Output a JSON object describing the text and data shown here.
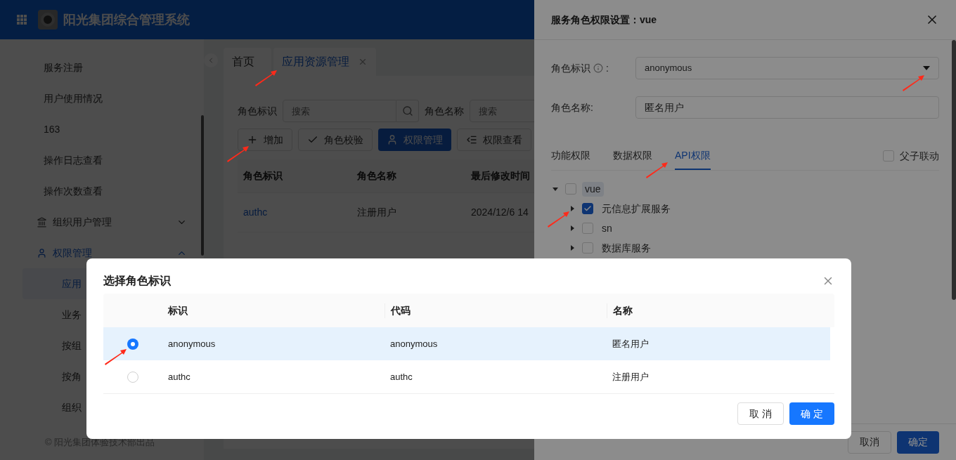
{
  "app": {
    "title": "阳光集团综合管理系统"
  },
  "sidebar": {
    "items": [
      {
        "label": "服务注册",
        "kind": "link"
      },
      {
        "label": "用户使用情况",
        "kind": "link"
      },
      {
        "label": "163",
        "kind": "link"
      },
      {
        "label": "操作日志查看",
        "kind": "link"
      },
      {
        "label": "操作次数查看",
        "kind": "link"
      },
      {
        "label": "组织用户管理",
        "kind": "group",
        "active": false,
        "expanded": false
      },
      {
        "label": "权限管理",
        "kind": "group",
        "active": true,
        "expanded": true,
        "children": [
          {
            "label": "应用",
            "selected": true
          },
          {
            "label": "业务",
            "selected": false
          },
          {
            "label": "按组",
            "selected": false
          },
          {
            "label": "按角",
            "selected": false
          },
          {
            "label": "组织",
            "selected": false
          }
        ]
      }
    ],
    "footer": "© 阳光集团体验技术部出品"
  },
  "page_tabs": [
    {
      "label": "首页",
      "selected": false,
      "closable": false
    },
    {
      "label": "应用资源管理",
      "selected": true,
      "closable": true
    }
  ],
  "filters": [
    {
      "label": "角色标识",
      "placeholder": "搜索",
      "search_button": true
    },
    {
      "label": "角色名称",
      "placeholder": "搜索",
      "search_button": false
    }
  ],
  "toolbar": [
    {
      "label": "增加",
      "primary": false
    },
    {
      "label": "角色校验",
      "primary": false
    },
    {
      "label": "权限管理",
      "primary": true
    },
    {
      "label": "权限查看",
      "primary": false
    }
  ],
  "table": {
    "columns": [
      "角色标识",
      "角色名称",
      "最后修改时间"
    ],
    "rows": [
      [
        "authc",
        "注册用户",
        "2024/12/6 14"
      ]
    ]
  },
  "drawer": {
    "title": "服务角色权限设置：vue",
    "role_id": {
      "label": "角色标识",
      "suffix": ":",
      "value": "anonymous"
    },
    "role_name": {
      "label": "角色名称:",
      "value": "匿名用户"
    },
    "tabs": [
      {
        "label": "功能权限",
        "selected": false
      },
      {
        "label": "数据权限",
        "selected": false
      },
      {
        "label": "API权限",
        "selected": true
      }
    ],
    "link_toggle": {
      "label": "父子联动",
      "checked": false
    },
    "tree": [
      {
        "label": "vue",
        "checked": false,
        "expanded": true,
        "children": [
          {
            "label": "元信息扩展服务",
            "checked": true,
            "expanded": false
          },
          {
            "label": "sn",
            "checked": false,
            "expanded": false
          },
          {
            "label": "数据库服务",
            "checked": false,
            "expanded": false
          }
        ]
      }
    ],
    "buttons": [
      {
        "label": "取消",
        "primary": false
      },
      {
        "label": "确定",
        "primary": true
      }
    ]
  },
  "modal": {
    "title": "选择角色标识",
    "columns": [
      "标识",
      "代码",
      "名称"
    ],
    "rows": [
      {
        "cells": [
          "anonymous",
          "anonymous",
          "匿名用户"
        ],
        "selected": true
      },
      {
        "cells": [
          "authc",
          "authc",
          "注册用户"
        ],
        "selected": false
      }
    ],
    "buttons": [
      {
        "label": "取 消",
        "primary": false
      },
      {
        "label": "确 定",
        "primary": true
      }
    ]
  }
}
